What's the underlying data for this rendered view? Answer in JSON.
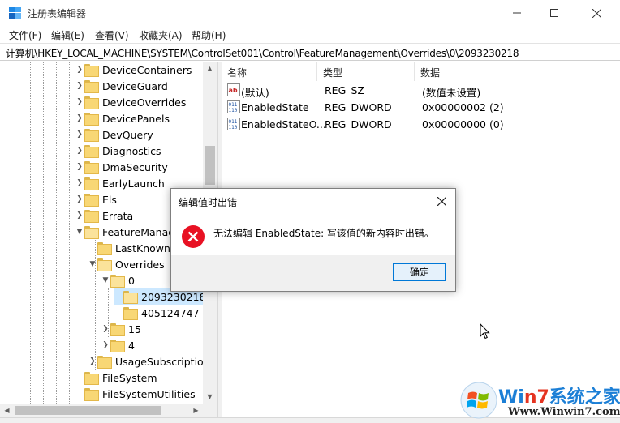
{
  "window": {
    "title": "注册表编辑器",
    "controls": {
      "minimize": "minimize-icon",
      "maximize": "maximize-icon",
      "close": "close-icon"
    }
  },
  "menu": {
    "items": [
      {
        "label": "文件(F)"
      },
      {
        "label": "编辑(E)"
      },
      {
        "label": "查看(V)"
      },
      {
        "label": "收藏夹(A)"
      },
      {
        "label": "帮助(H)"
      }
    ]
  },
  "address": {
    "path": "计算机\\HKEY_LOCAL_MACHINE\\SYSTEM\\ControlSet001\\Control\\FeatureManagement\\Overrides\\0\\2093230218"
  },
  "tree": {
    "rows": [
      {
        "label": "DeviceContainers",
        "expander": "collapsed"
      },
      {
        "label": "DeviceGuard",
        "expander": "collapsed"
      },
      {
        "label": "DeviceOverrides",
        "expander": "collapsed"
      },
      {
        "label": "DevicePanels",
        "expander": "collapsed"
      },
      {
        "label": "DevQuery",
        "expander": "collapsed"
      },
      {
        "label": "Diagnostics",
        "expander": "collapsed"
      },
      {
        "label": "DmaSecurity",
        "expander": "collapsed"
      },
      {
        "label": "EarlyLaunch",
        "expander": "collapsed"
      },
      {
        "label": "Els",
        "expander": "collapsed"
      },
      {
        "label": "Errata",
        "expander": "collapsed"
      },
      {
        "label": "FeatureManag",
        "expander": "expanded"
      },
      {
        "label": "LastKnownG",
        "expander": "none"
      },
      {
        "label": "Overrides",
        "expander": "expanded"
      },
      {
        "label": "0",
        "expander": "expanded"
      },
      {
        "label": "2093230218",
        "expander": "none",
        "selected": true
      },
      {
        "label": "405124747",
        "expander": "none"
      },
      {
        "label": "15",
        "expander": "collapsed"
      },
      {
        "label": "4",
        "expander": "collapsed"
      },
      {
        "label": "UsageSubscriptio",
        "expander": "collapsed"
      },
      {
        "label": "FileSystem",
        "expander": "none"
      },
      {
        "label": "FileSystemUtilities",
        "expander": "none"
      }
    ]
  },
  "list": {
    "columns": [
      {
        "label": "名称"
      },
      {
        "label": "类型"
      },
      {
        "label": "数据"
      }
    ],
    "rows": [
      {
        "name": "(默认)",
        "type": "REG_SZ",
        "data": "(数值未设置)",
        "icon": "string-value-icon"
      },
      {
        "name": "EnabledState",
        "type": "REG_DWORD",
        "data": "0x00000002 (2)",
        "icon": "binary-value-icon"
      },
      {
        "name": "EnabledStateO...",
        "type": "REG_DWORD",
        "data": "0x00000000 (0)",
        "icon": "binary-value-icon"
      }
    ]
  },
  "dialog": {
    "title": "编辑值时出错",
    "message": "无法编辑 EnabledState: 写该值的新内容时出错。",
    "ok_label": "确定",
    "icon": "error-icon"
  },
  "watermark": {
    "brand_blue_1": "Wi",
    "brand_red": "n7",
    "brand_blue_2": "系统之家",
    "url": "Www.Winwin7.com"
  },
  "colors": {
    "selection": "#cce8ff",
    "accent": "#0078d7",
    "error": "#e81123"
  }
}
